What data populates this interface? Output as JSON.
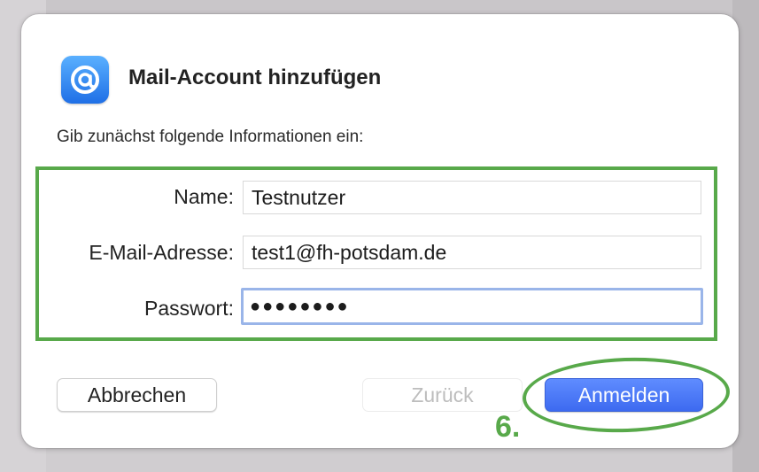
{
  "dialog": {
    "title": "Mail-Account hinzufügen",
    "intro": "Gib zunächst folgende Informationen ein:",
    "icon": "at-sign-icon"
  },
  "form": {
    "name_label": "Name:",
    "name_value": "Testnutzer",
    "email_label": "E-Mail-Adresse:",
    "email_value": "test1@fh-potsdam.de",
    "password_label": "Passwort:",
    "password_value": "●●●●●●●●"
  },
  "buttons": {
    "cancel": "Abbrechen",
    "back": "Zurück",
    "login": "Anmelden"
  },
  "annotation": {
    "step": "6.",
    "color": "#58a94a"
  },
  "colors": {
    "accent": "#3d6af0",
    "focus_ring": "#9ab5e9"
  }
}
